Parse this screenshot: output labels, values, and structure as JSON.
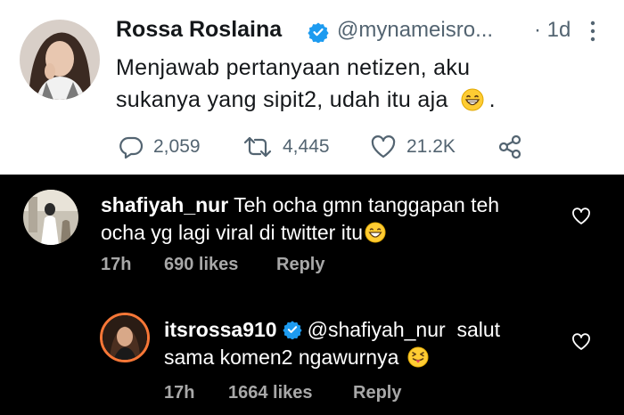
{
  "tweet": {
    "name": "Rossa Roslaina",
    "handle": "@mynameisro...",
    "time": "· 1d",
    "text_line1": "Menjawab pertanyaan netizen, aku",
    "text_line2": "sukanya yang sipit2, udah itu aja",
    "text_end": ".",
    "emoji": "grinning-face-emoji",
    "replies": "2,059",
    "retweets": "4,445",
    "likes": "21.2K"
  },
  "comments": [
    {
      "username": "shafiyah_nur",
      "text_line1": "Teh ocha gmn tanggapan teh",
      "text_line2": "ocha yg lagi viral di twitter itu",
      "emoji": "grinning-face-emoji",
      "time": "17h",
      "likes": "690 likes",
      "reply": "Reply"
    },
    {
      "username": "itsrossa910",
      "mention": "@shafiyah_nur",
      "text_line1": "salut",
      "text_line2": "sama komen2 ngawurnya",
      "emoji": "squinting-tongue-emoji",
      "time": "17h",
      "likes": "1664 likes",
      "reply": "Reply"
    }
  ],
  "colors": {
    "verified_blue": "#1d9bf0",
    "story_ring": "#f77737",
    "meta_gray": "#a8a8a8"
  }
}
